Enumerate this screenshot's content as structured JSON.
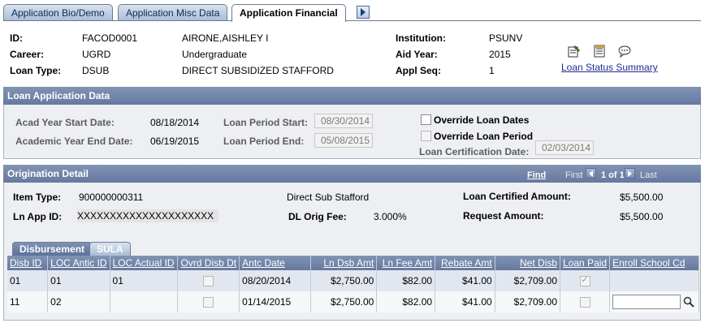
{
  "tabs": [
    {
      "label": "Application Bio/Demo",
      "active": false
    },
    {
      "label": "Application Misc Data",
      "active": false
    },
    {
      "label": "Application Financial",
      "active": true
    }
  ],
  "header": {
    "id_label": "ID:",
    "id_value": "FACOD0001",
    "name": "AIRONE,AISHLEY I",
    "career_label": "Career:",
    "career_value": "UGRD",
    "career_desc": "Undergraduate",
    "loan_type_label": "Loan Type:",
    "loan_type_value": "DSUB",
    "loan_type_desc": "DIRECT SUBSIDIZED STAFFORD",
    "institution_label": "Institution:",
    "institution_value": "PSUNV",
    "aid_year_label": "Aid Year:",
    "aid_year_value": "2015",
    "appl_seq_label": "Appl Seq:",
    "appl_seq_value": "1",
    "loan_status_link": "Loan Status Summary"
  },
  "loan_app": {
    "title": "Loan Application Data",
    "acad_start_label": "Acad Year Start Date:",
    "acad_start_value": "08/18/2014",
    "acad_end_label": "Academic Year End Date:",
    "acad_end_value": "06/19/2015",
    "period_start_label": "Loan Period Start:",
    "period_start_value": "08/30/2014",
    "period_end_label": "Loan Period End:",
    "period_end_value": "05/08/2015",
    "override_dates_label": "Override Loan Dates",
    "override_period_label": "Override Loan Period",
    "cert_date_label": "Loan Certification Date:",
    "cert_date_value": "02/03/2014"
  },
  "origination": {
    "title": "Origination Detail",
    "find": "Find",
    "first": "First",
    "count": "1 of 1",
    "last": "Last",
    "item_type_label": "Item Type:",
    "item_type_value": "900000000311",
    "item_type_desc": "Direct Sub Stafford",
    "ln_app_id_label": "Ln App ID:",
    "ln_app_id_value": "XXXXXXXXXXXXXXXXXXXXX",
    "dl_fee_label": "DL Orig Fee:",
    "dl_fee_value": "3.000%",
    "cert_amount_label": "Loan Certified Amount:",
    "cert_amount_value": "$5,500.00",
    "request_amount_label": "Request Amount:",
    "request_amount_value": "$5,500.00"
  },
  "grid": {
    "tabs": [
      "Disbursement",
      "SULA"
    ],
    "columns": [
      "Disb ID",
      "LOC Antic ID",
      "LOC Actual ID",
      "Ovrd Disb Dt",
      "Antc Date",
      "Ln Dsb Amt",
      "Ln Fee Amt",
      "Rebate Amt",
      "Net Disb",
      "Loan Paid",
      "Enroll School Cd"
    ],
    "rows": [
      {
        "disb_id": "01",
        "loc_antic": "01",
        "loc_actual": "01",
        "antc_date": "08/20/2014",
        "ln_dsb": "$2,750.00",
        "ln_fee": "$82.00",
        "rebate": "$41.00",
        "net": "$2,709.00"
      },
      {
        "disb_id": "11",
        "loc_antic": "02",
        "loc_actual": "",
        "antc_date": "01/14/2015",
        "ln_dsb": "$2,750.00",
        "ln_fee": "$82.00",
        "rebate": "$41.00",
        "net": "$2,709.00"
      }
    ]
  }
}
